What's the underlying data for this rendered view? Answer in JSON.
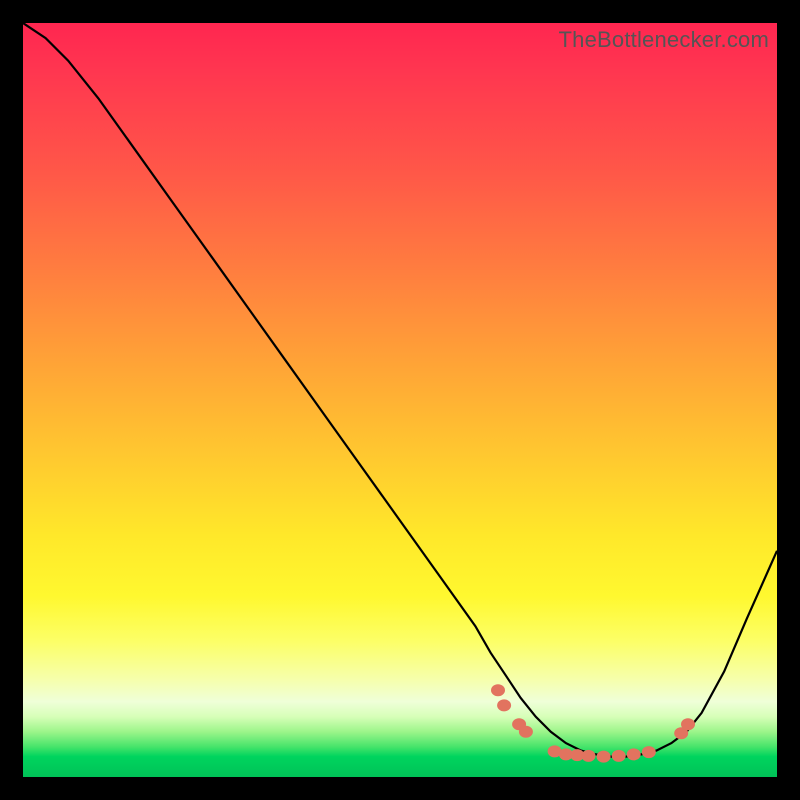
{
  "watermark_text": "TheBottlenecker.com",
  "colors": {
    "frame": "#000000",
    "gradient_top": "#ff2650",
    "gradient_bottom": "#00c257",
    "curve": "#000000",
    "markers": "#e2735f"
  },
  "chart_data": {
    "type": "line",
    "title": "",
    "xlabel": "",
    "ylabel": "",
    "xlim": [
      0,
      100
    ],
    "ylim": [
      0,
      100
    ],
    "note": "Axes not shown in image; values are estimated percentages of plot width/height. y is plotted downward (screen coords).",
    "series": [
      {
        "name": "bottleneck-curve",
        "x": [
          0,
          3,
          6,
          10,
          15,
          20,
          25,
          30,
          35,
          40,
          45,
          50,
          55,
          60,
          62,
          64,
          66,
          68,
          70,
          72,
          74,
          76,
          78,
          80,
          82,
          84,
          86,
          88,
          90,
          93,
          96,
          100
        ],
        "y": [
          0,
          2,
          5,
          10,
          17,
          24,
          31,
          38,
          45,
          52,
          59,
          66,
          73,
          80,
          83.5,
          86.5,
          89.5,
          92,
          94,
          95.5,
          96.5,
          97,
          97.3,
          97.3,
          97,
          96.5,
          95.5,
          94,
          91.5,
          86,
          79,
          70
        ]
      }
    ],
    "markers": {
      "name": "highlight-points",
      "note": "Clustered near curve minimum (~x 64–88). Values estimated.",
      "points": [
        {
          "x": 63.0,
          "y": 88.5
        },
        {
          "x": 63.8,
          "y": 90.5
        },
        {
          "x": 65.8,
          "y": 93.0
        },
        {
          "x": 66.7,
          "y": 94.0
        },
        {
          "x": 70.5,
          "y": 96.6
        },
        {
          "x": 72.0,
          "y": 97.0
        },
        {
          "x": 73.5,
          "y": 97.1
        },
        {
          "x": 75.0,
          "y": 97.2
        },
        {
          "x": 77.0,
          "y": 97.3
        },
        {
          "x": 79.0,
          "y": 97.2
        },
        {
          "x": 81.0,
          "y": 97.0
        },
        {
          "x": 83.0,
          "y": 96.7
        },
        {
          "x": 87.3,
          "y": 94.2
        },
        {
          "x": 88.2,
          "y": 93.0
        }
      ]
    }
  }
}
